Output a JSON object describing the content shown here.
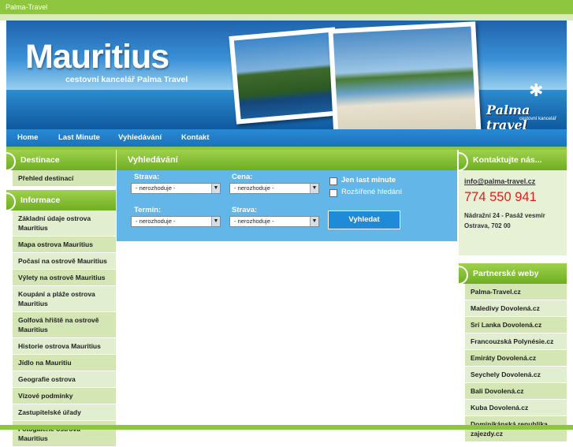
{
  "topbar": {
    "title": "Palma-Travel"
  },
  "banner": {
    "title": "Mauritius",
    "subtitle": "cestovní kancelář Palma Travel",
    "logo_name": "Palma travel",
    "logo_sub": "cestovní kancelář"
  },
  "nav": {
    "items": [
      "Home",
      "Last Minute",
      "Vyhledávání",
      "Kontakt"
    ]
  },
  "left": {
    "destinace_header": "Destinace",
    "destinace_items": [
      "Přehled destinací"
    ],
    "informace_header": "Informace",
    "informace_items": [
      "Základní údaje ostrova Mauritius",
      "Mapa ostrova Mauritius",
      "Počasí na ostrově Mauritius",
      "Výlety na ostrově Mauritius",
      "Koupání a pláže ostrova Mauritius",
      "Golfová hřiště na ostrově Mauritius",
      "Historie ostrova Mauritius",
      "Jídlo na Mauritiu",
      "Geografie ostrova",
      "Vízové podmínky",
      "Zastupitelské úřady",
      "Fotogalerie ostrova Mauritius"
    ]
  },
  "search": {
    "header": "Vyhledávání",
    "strava_label": "Strava:",
    "cena_label": "Cena:",
    "termin_label": "Termín:",
    "strava2_label": "Strava:",
    "select_default": "- nerozhoduje -",
    "last_minute_label": "Jen last minute",
    "advanced_label": "Rozšířené hledání",
    "submit": "Vyhledat"
  },
  "contact": {
    "header": "Kontaktujte nás...",
    "email": "info@palma-travel.cz",
    "phone": "774 550 941",
    "address1": "Nádražní 24 - Pasáž vesmír",
    "address2": "Ostrava, 702 00"
  },
  "partners": {
    "header": "Partnerské weby",
    "items": [
      "Palma-Travel.cz",
      "Maledivy Dovolená.cz",
      "Srí Lanka Dovolená.cz",
      "Francouzská Polynésie.cz",
      "Emiráty Dovolená.cz",
      "Seychely Dovolená.cz",
      "Bali Dovolená.cz",
      "Kuba Dovolená.cz",
      "Dominikánská republika zajezdy.cz"
    ]
  },
  "colors": {
    "green": "#8ec63f",
    "blue": "#62b7e8",
    "phone_red": "#e31d1d"
  }
}
